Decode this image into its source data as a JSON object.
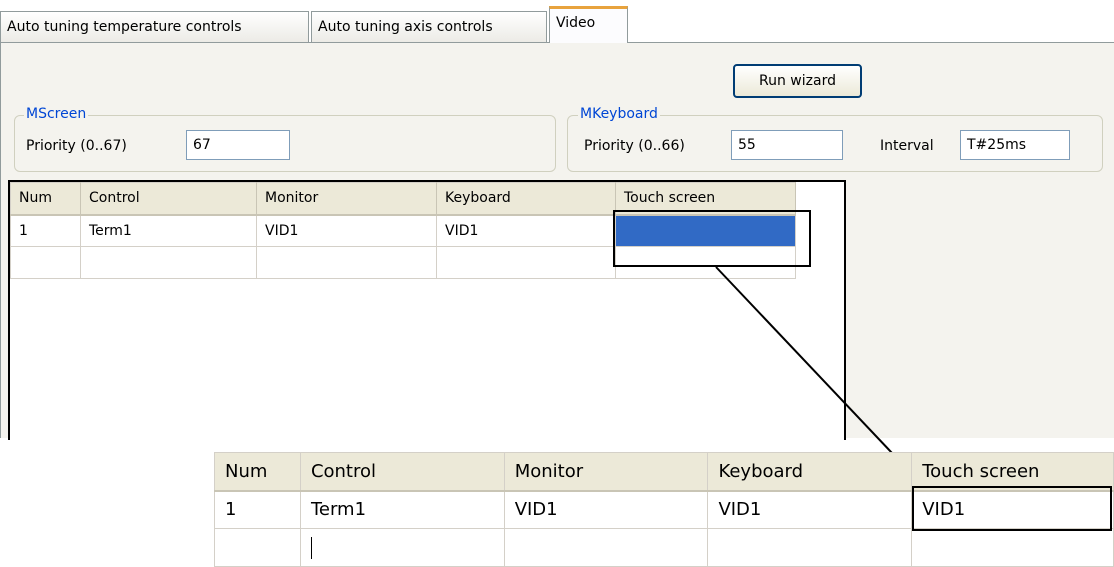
{
  "tabs": [
    {
      "label": "Auto tuning temperature controls"
    },
    {
      "label": "Auto tuning axis controls"
    },
    {
      "label": "Video",
      "active": true
    }
  ],
  "toolbar": {
    "run_wizard_label": "Run wizard"
  },
  "mscreen": {
    "title": "MScreen",
    "priority_label": "Priority (0..67)",
    "priority_value": "67"
  },
  "mkeyboard": {
    "title": "MKeyboard",
    "priority_label": "Priority (0..66)",
    "priority_value": "55",
    "interval_label": "Interval",
    "interval_value": "T#25ms"
  },
  "grid": {
    "columns": [
      "Num",
      "Control",
      "Monitor",
      "Keyboard",
      "Touch screen"
    ],
    "rows": [
      [
        "1",
        "Term1",
        "VID1",
        "VID1",
        ""
      ],
      [
        "",
        "",
        "",
        "",
        ""
      ]
    ]
  },
  "zoom_grid": {
    "columns": [
      "Num",
      "Control",
      "Monitor",
      "Keyboard",
      "Touch screen"
    ],
    "rows": [
      [
        "1",
        "Term1",
        "VID1",
        "VID1",
        "VID1"
      ],
      [
        "",
        "",
        "",
        "",
        ""
      ]
    ]
  },
  "colors": {
    "accent": "#316ac5",
    "group_title": "#0046d5",
    "tab_highlight": "#e8a33d",
    "panel_bg": "#f4f3ee"
  }
}
